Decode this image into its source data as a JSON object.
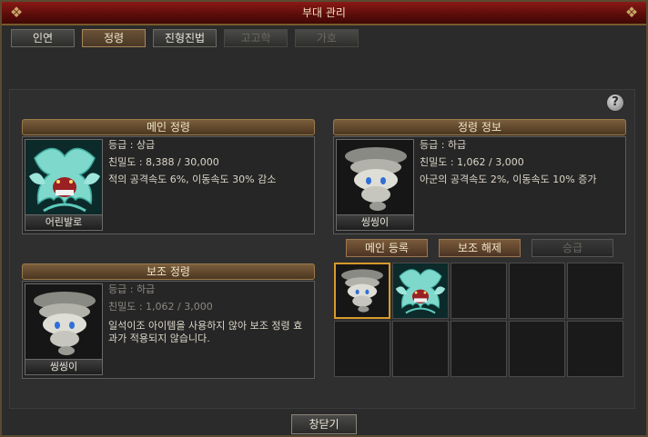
{
  "window": {
    "title": "부대 관리"
  },
  "tabs": [
    {
      "label": "인연",
      "state": "normal"
    },
    {
      "label": "정령",
      "state": "active"
    },
    {
      "label": "진형진법",
      "state": "normal"
    },
    {
      "label": "고고학",
      "state": "disabled"
    },
    {
      "label": "가호",
      "state": "disabled"
    }
  ],
  "main_spirit": {
    "header": "메인 정령",
    "name": "어린발로",
    "portrait_icon": "teal-dragon-icon",
    "grade": "등급 : 상급",
    "intimacy": "친밀도 : 8,388 / 30,000",
    "effect": "적의 공격속도 6%, 이동속도 30% 감소"
  },
  "sub_spirit": {
    "header": "보조 정령",
    "name": "씽씽이",
    "portrait_icon": "white-tornado-icon",
    "grade": "등급 : 하급",
    "intimacy": "친밀도 : 1,062 / 3,000",
    "notice": "일석이조 아이템을 사용하지 않아 보조 정령 효과가 적용되지 않습니다."
  },
  "spirit_info": {
    "header": "정령 정보",
    "name": "씽씽이",
    "portrait_icon": "white-tornado-icon",
    "grade": "등급 : 하급",
    "intimacy": "친밀도 : 1,062 / 3,000",
    "effect": "아군의 공격속도 2%, 이동속도 10% 증가"
  },
  "actions": {
    "register_main": "메인 등록",
    "release_sub": "보조 해제",
    "promote": "승급"
  },
  "inventory": {
    "slots": [
      {
        "icon": "white-tornado-icon",
        "selected": true
      },
      {
        "icon": "teal-dragon-icon",
        "selected": false
      },
      {
        "icon": "",
        "selected": false
      },
      {
        "icon": "",
        "selected": false
      },
      {
        "icon": "",
        "selected": false
      },
      {
        "icon": "",
        "selected": false
      },
      {
        "icon": "",
        "selected": false
      },
      {
        "icon": "",
        "selected": false
      },
      {
        "icon": "",
        "selected": false
      },
      {
        "icon": "",
        "selected": false
      }
    ]
  },
  "footer": {
    "close_label": "창닫기"
  },
  "help_label": "?"
}
